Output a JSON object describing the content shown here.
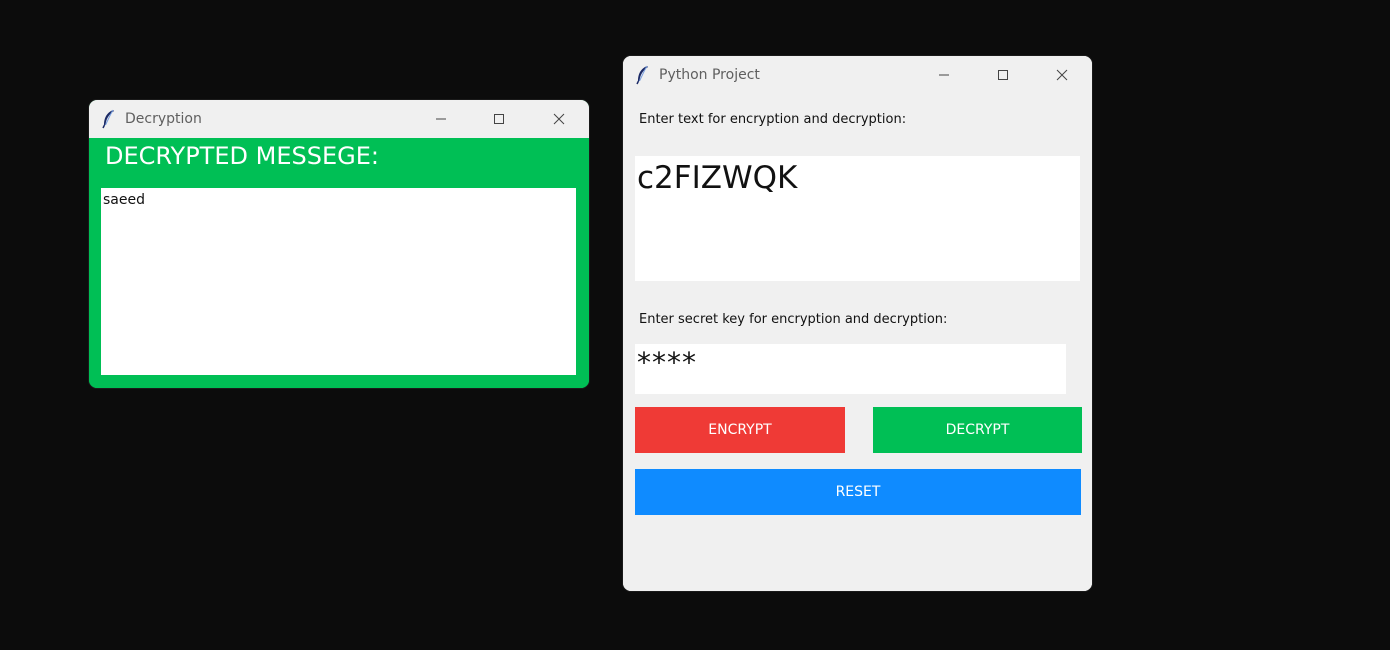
{
  "decryption_window": {
    "title": "Decryption",
    "heading": "DECRYPTED MESSEGE:",
    "output_text": "saeed",
    "colors": {
      "background": "#00bf55"
    }
  },
  "main_window": {
    "title": "Python Project",
    "text_label": "Enter text for encryption and decryption:",
    "text_value": "c2FIZWQK",
    "key_label": "Enter secret key for encryption and decryption:",
    "key_value": "****",
    "buttons": {
      "encrypt": "ENCRYPT",
      "decrypt": "DECRYPT",
      "reset": "RESET"
    },
    "colors": {
      "encrypt": "#ef3a36",
      "decrypt": "#00bf55",
      "reset": "#0f8bff"
    }
  },
  "window_controls": {
    "minimize_icon": "minimize-icon",
    "maximize_icon": "maximize-icon",
    "close_icon": "close-icon",
    "app_icon": "feather-icon"
  }
}
